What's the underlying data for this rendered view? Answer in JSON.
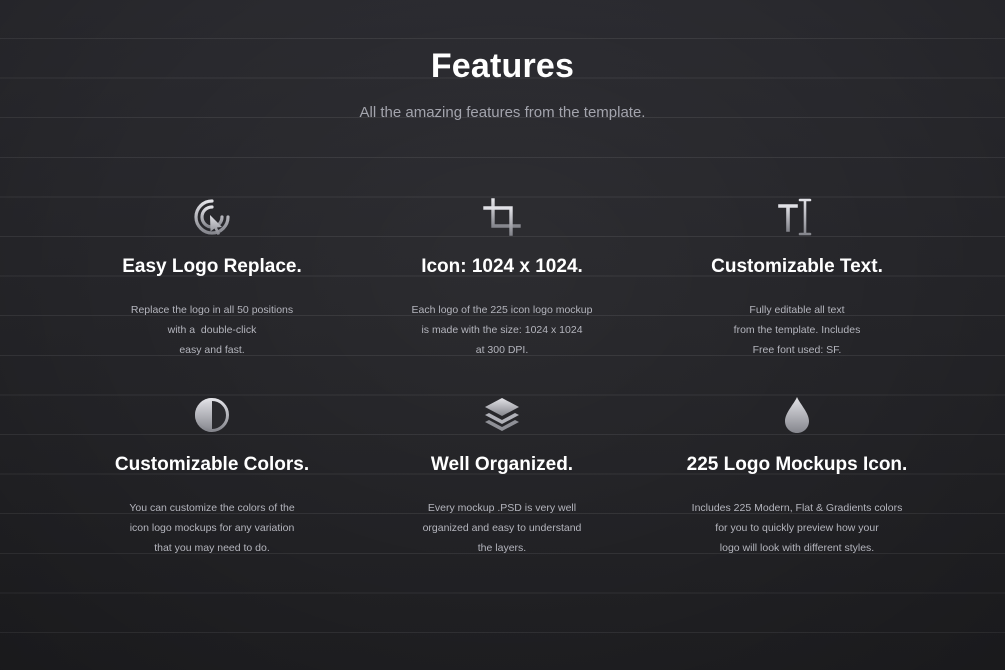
{
  "header": {
    "title": "Features",
    "subtitle": "All the amazing features from the template."
  },
  "features": [
    {
      "icon": "cursor-click-icon",
      "title": "Easy Logo Replace.",
      "desc": [
        "Replace the logo in all 50 positions",
        "with a  double-click",
        "easy and fast."
      ]
    },
    {
      "icon": "crop-icon",
      "title": "Icon: 1024 x 1024.",
      "desc": [
        "Each logo of the 225 icon logo mockup",
        "is made with the size: 1024 x 1024",
        "at 300 DPI."
      ]
    },
    {
      "icon": "text-cursor-icon",
      "title": "Customizable Text.",
      "desc": [
        "Fully editable all text",
        "from the template. Includes",
        "Free font used: SF."
      ]
    },
    {
      "icon": "half-circle-contrast-icon",
      "title": "Customizable Colors.",
      "desc": [
        "You can customize the colors of the",
        "icon logo mockups for any variation",
        "that you may need to do."
      ]
    },
    {
      "icon": "layers-icon",
      "title": "Well Organized.",
      "desc": [
        "Every mockup .PSD is very well",
        "organized and easy to understand",
        "the layers."
      ]
    },
    {
      "icon": "droplet-icon",
      "title": "225 Logo Mockups Icon.",
      "desc": [
        "Includes 225 Modern, Flat & Gradients colors",
        "for you to quickly preview how your",
        "logo will look with different styles."
      ]
    }
  ],
  "colors": {
    "background": "#252529",
    "title": "#ffffff",
    "subtitle": "#a3a4ad",
    "description": "#b4b5bd",
    "icon_light": "#d9d9de",
    "icon_dark": "#8a8b92"
  }
}
